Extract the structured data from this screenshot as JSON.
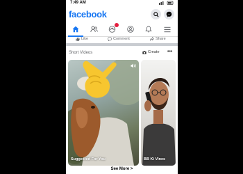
{
  "status": {
    "time": "7:49 AM"
  },
  "header": {
    "logo": "facebook"
  },
  "post_actions": {
    "like": "Like",
    "comment": "Comment",
    "share": "Share"
  },
  "short_videos": {
    "title": "Short Videos",
    "create_label": "Create",
    "more_label": "•••",
    "cards": [
      {
        "label": "Suggested For You"
      },
      {
        "label": "BB Ki Vines"
      }
    ],
    "see_more": "See More",
    "see_more_chevron": ">"
  },
  "colors": {
    "brand": "#1877f2",
    "badge": "#e41e3f"
  },
  "icons": [
    "search-icon",
    "messenger-icon",
    "home-icon",
    "friends-icon",
    "groups-icon",
    "profile-icon",
    "bell-icon",
    "menu-icon",
    "sound-icon"
  ]
}
